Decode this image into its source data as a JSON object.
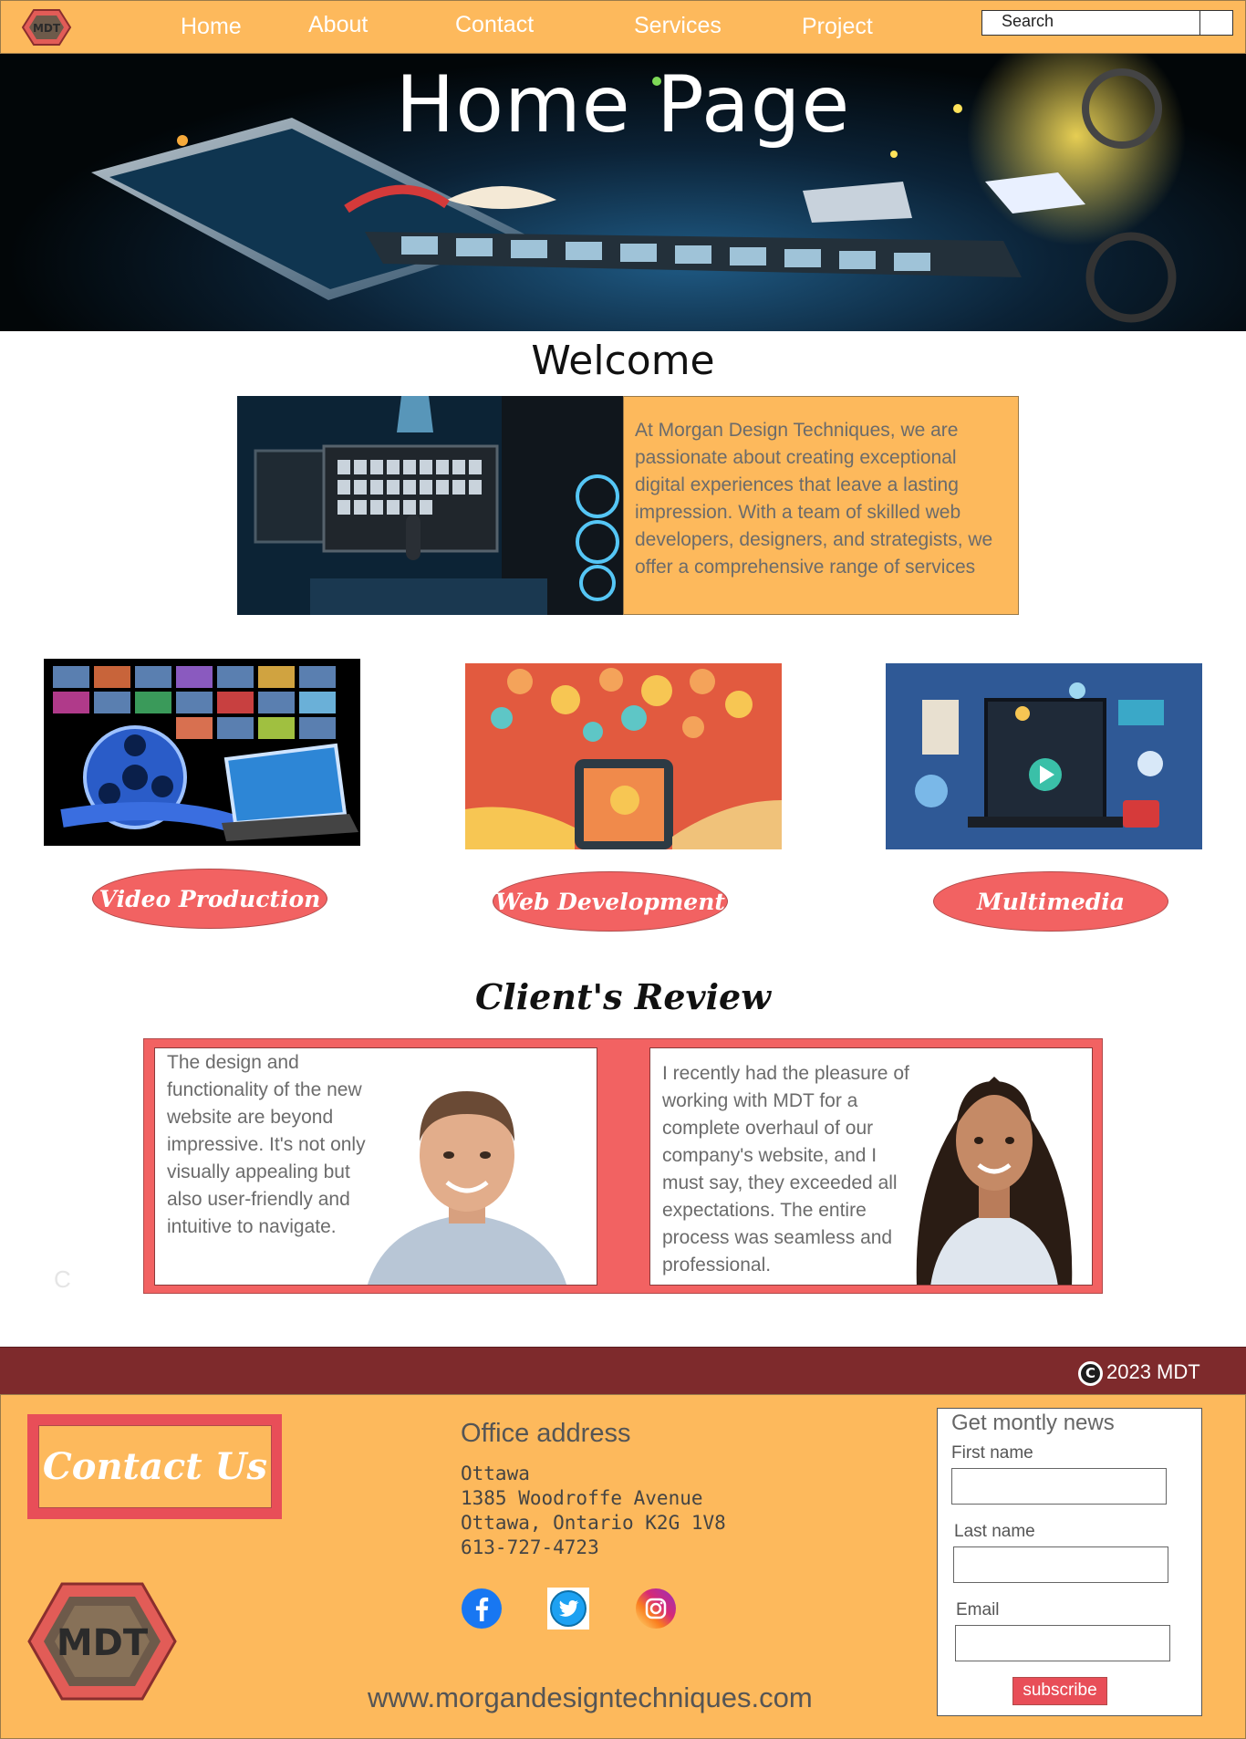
{
  "nav": {
    "links": [
      "Home",
      "About",
      "Contact",
      "Services",
      "Project"
    ],
    "search_placeholder": "Search",
    "logo_text": "MDT"
  },
  "hero": {
    "title": "Home Page"
  },
  "welcome": {
    "heading": "Welcome",
    "body": "At Morgan Design Techniques, we are passionate about creating exceptional digital experiences that leave a lasting impression. With a team of skilled web developers, designers, and strategists, we offer a comprehensive range of services"
  },
  "services": [
    {
      "label": "Video Production"
    },
    {
      "label": "Web Development"
    },
    {
      "label": "Multimedia"
    }
  ],
  "reviews": {
    "heading": "Client's Review",
    "items": [
      {
        "text": "The design and functionality of the new website are beyond impressive. It's not only visually appealing but also user-friendly and intuitive to navigate."
      },
      {
        "text": "I recently had the pleasure of working with MDT for a complete overhaul of our company's website, and I must say, they exceeded all expectations. The entire process was seamless and professional."
      }
    ],
    "stray_char": "C"
  },
  "copyright": {
    "symbol": "C",
    "text": "2023 MDT"
  },
  "footer": {
    "contact_label": "Contact Us",
    "logo_text": "MDT",
    "office": {
      "title": "Office address",
      "lines": [
        "Ottawa",
        "1385 Woodroffe Avenue",
        "Ottawa, Ontario K2G 1V8",
        "613-727-4723"
      ]
    },
    "website": "www.morgandesigntechniques.com",
    "newsletter": {
      "title": "Get montly news",
      "first_name_label": "First name",
      "last_name_label": "Last name",
      "email_label": "Email",
      "subscribe_label": "subscribe"
    }
  },
  "colors": {
    "nav_bg": "#fdb95c",
    "accent_red": "#f26262",
    "footer_bar": "#7e2a2c",
    "text_gray": "#6b6b6b"
  },
  "icons": [
    "facebook-icon",
    "twitter-icon",
    "instagram-icon",
    "copyright-icon"
  ]
}
